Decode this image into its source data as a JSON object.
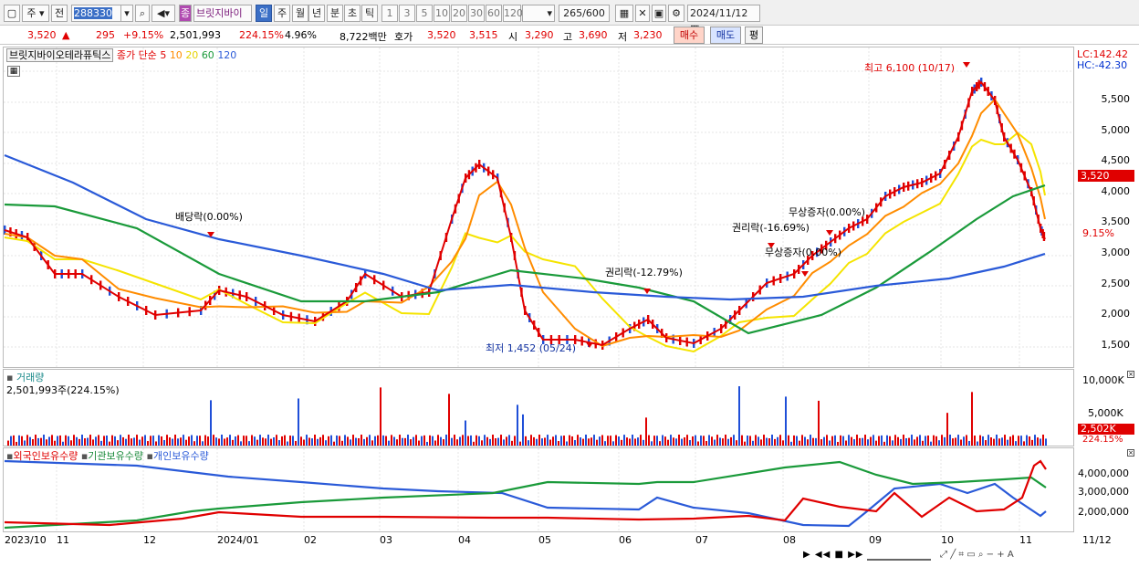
{
  "toolbar": {
    "market": "주",
    "prev": "전",
    "code": "288330",
    "name_badge": "종",
    "name": "브릿지바이",
    "period": [
      "일",
      "주",
      "월",
      "년",
      "분",
      "초",
      "틱"
    ],
    "minutes": [
      "1",
      "3",
      "5",
      "10",
      "20",
      "30",
      "60",
      "120"
    ],
    "count": "265",
    "total": "/600",
    "date": "2024/11/12"
  },
  "quote": {
    "price": "3,520",
    "change": "295",
    "change_pct": "+9.15%",
    "volume": "2,501,993",
    "vol_ratio": "224.15%",
    "turnover": "4.96%",
    "amount": "8,722백만",
    "hoga_label": "호가",
    "hoga_ask": "3,520",
    "hoga_bid": "3,515",
    "open_label": "시",
    "open": "3,290",
    "high_label": "고",
    "high": "3,690",
    "low_label": "저",
    "low": "3,230",
    "buy": "매수",
    "sell": "매도",
    "eval": "평"
  },
  "price_panel": {
    "stock": "브릿지바이오테라퓨틱스",
    "ma_label": "종가 단순",
    "ma": [
      "5",
      "10",
      "20",
      "60",
      "120"
    ],
    "lc": "LC:142.42",
    "hc": "HC:-42.30",
    "high_note": "최고 6,100 (10/17)",
    "low_note": "최저 1,452 (05/24)",
    "events": [
      "배당락(0.00%)",
      "권리락(-12.79%)",
      "권리락(-16.69%)",
      "무상증자(0.00%)",
      "무상증자(0.00%)"
    ],
    "axis": [
      "5,500",
      "5,000",
      "4,500",
      "4,000",
      "3,500",
      "3,000",
      "2,500",
      "2,000",
      "1,500"
    ],
    "cur": "3,520",
    "cur_pct": "9.15%"
  },
  "volume_panel": {
    "title": "거래량",
    "value": "2,501,993주(224.15%)",
    "axis": [
      "10,000K",
      "5,000K"
    ],
    "cur": "2,502K",
    "cur_pct": "224.15%"
  },
  "holder_panel": {
    "legend": [
      "외국인보유수량",
      "기관보유수량",
      "개인보유수량"
    ],
    "axis": [
      "4,000,000",
      "3,000,000",
      "2,000,000"
    ]
  },
  "xaxis": [
    "2023/10",
    "11",
    "12",
    "2024/01",
    "02",
    "03",
    "04",
    "05",
    "06",
    "07",
    "08",
    "09",
    "10",
    "11",
    "11/12"
  ],
  "colors": {
    "up": "#e00000",
    "down": "#1f4fd8",
    "ma5": "#e00000",
    "ma10": "#ff8c00",
    "ma20": "#f5e400",
    "ma60": "#1a9a3a",
    "ma120": "#2a5ad8"
  }
}
